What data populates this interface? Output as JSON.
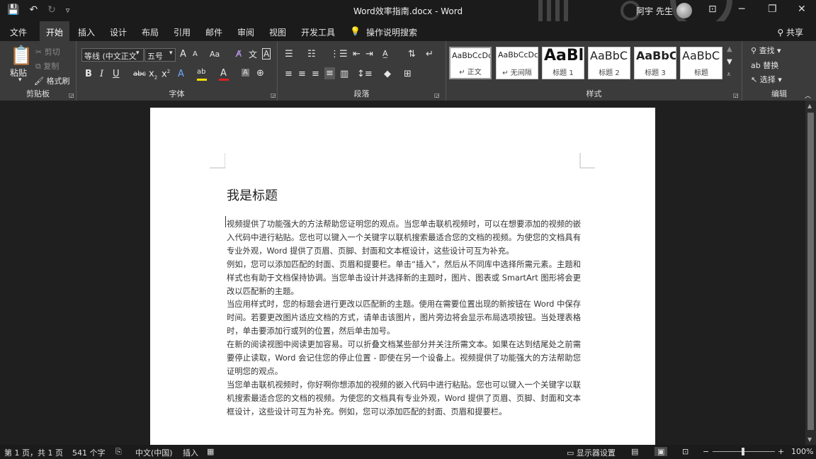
{
  "titlebar": {
    "doc_title": "Word效率指南.docx  -  Word",
    "user_name": "阿宇 先生",
    "save_icon": "💾",
    "undo_icon": "↶",
    "redo_icon": "↻",
    "customize_icon": "▿",
    "ribbon_display_icon": "⊡",
    "minimize_icon": "─",
    "restore_icon": "❐",
    "close_icon": "✕"
  },
  "tabs": [
    {
      "label": "文件"
    },
    {
      "label": "开始"
    },
    {
      "label": "插入"
    },
    {
      "label": "设计"
    },
    {
      "label": "布局"
    },
    {
      "label": "引用"
    },
    {
      "label": "邮件"
    },
    {
      "label": "审阅"
    },
    {
      "label": "视图"
    },
    {
      "label": "开发工具"
    },
    {
      "label": "操作说明搜索"
    }
  ],
  "share_label": "共享",
  "ribbon": {
    "clipboard": {
      "label": "剪贴板",
      "paste": "粘贴",
      "cut": "剪切",
      "copy": "复制",
      "format_painter": "格式刷"
    },
    "font": {
      "label": "字体",
      "font_name": "等线 (中文正文",
      "font_size": "五号",
      "grow": "A",
      "shrink": "A",
      "change_case": "Aa",
      "bold": "B",
      "italic": "I",
      "underline": "U",
      "strikethrough": "abc",
      "subscript": "x",
      "superscript": "x"
    },
    "paragraph": {
      "label": "段落"
    },
    "styles": {
      "label": "样式",
      "items": [
        {
          "sample": "AaBbCcDc",
          "name": "↵ 正文"
        },
        {
          "sample": "AaBbCcDc",
          "name": "↵ 无间隔"
        },
        {
          "sample": "AaBl",
          "name": "标题 1"
        },
        {
          "sample": "AaBbC",
          "name": "标题 2"
        },
        {
          "sample": "AaBbC",
          "name": "标题 3"
        },
        {
          "sample": "AaBbC",
          "name": "标题"
        }
      ]
    },
    "editing": {
      "label": "编辑",
      "find": "查找",
      "replace": "替换",
      "select": "选择"
    }
  },
  "document": {
    "heading": "我是标题",
    "paragraphs": [
      "视频提供了功能强大的方法帮助您证明您的观点。当您单击联机视频时，可以在想要添加的视频的嵌入代码中进行粘贴。您也可以键入一个关键字以联机搜索最适合您的文档的视频。为使您的文档具有专业外观，Word 提供了页眉、页脚、封面和文本框设计，这些设计可互为补充。",
      "例如，您可以添加匹配的封面、页眉和提要栏。单击“插入”，然后从不同库中选择所需元素。主题和样式也有助于文档保持协调。当您单击设计并选择新的主题时，图片、图表或 SmartArt 图形将会更改以匹配新的主题。",
      "当应用样式时，您的标题会进行更改以匹配新的主题。使用在需要位置出现的新按钮在 Word 中保存时间。若要更改图片适应文档的方式，请单击该图片，图片旁边将会显示布局选项按钮。当处理表格时，单击要添加行或列的位置，然后单击加号。",
      "在新的阅读视图中阅读更加容易。可以折叠文档某些部分并关注所需文本。如果在达到结尾处之前需要停止读取，Word 会记住您的停止位置 - 即使在另一个设备上。视频提供了功能强大的方法帮助您证明您的观点。",
      "当您单击联机视频时，你好啊你想添加的视频的嵌入代码中进行粘贴。您也可以键入一个关键字以联机搜索最适合您的文档的视频。为使您的文档具有专业外观，Word 提供了页眉、页脚、封面和文本框设计，这些设计可互为补充。例如，您可以添加匹配的封面、页眉和提要栏。"
    ]
  },
  "statusbar": {
    "page": "第 1 页，共 1 页",
    "words": "541 个字",
    "language": "中文(中国)",
    "mode": "插入",
    "display_settings": "显示器设置",
    "zoom": "100%",
    "zoom_level": 1.0
  }
}
